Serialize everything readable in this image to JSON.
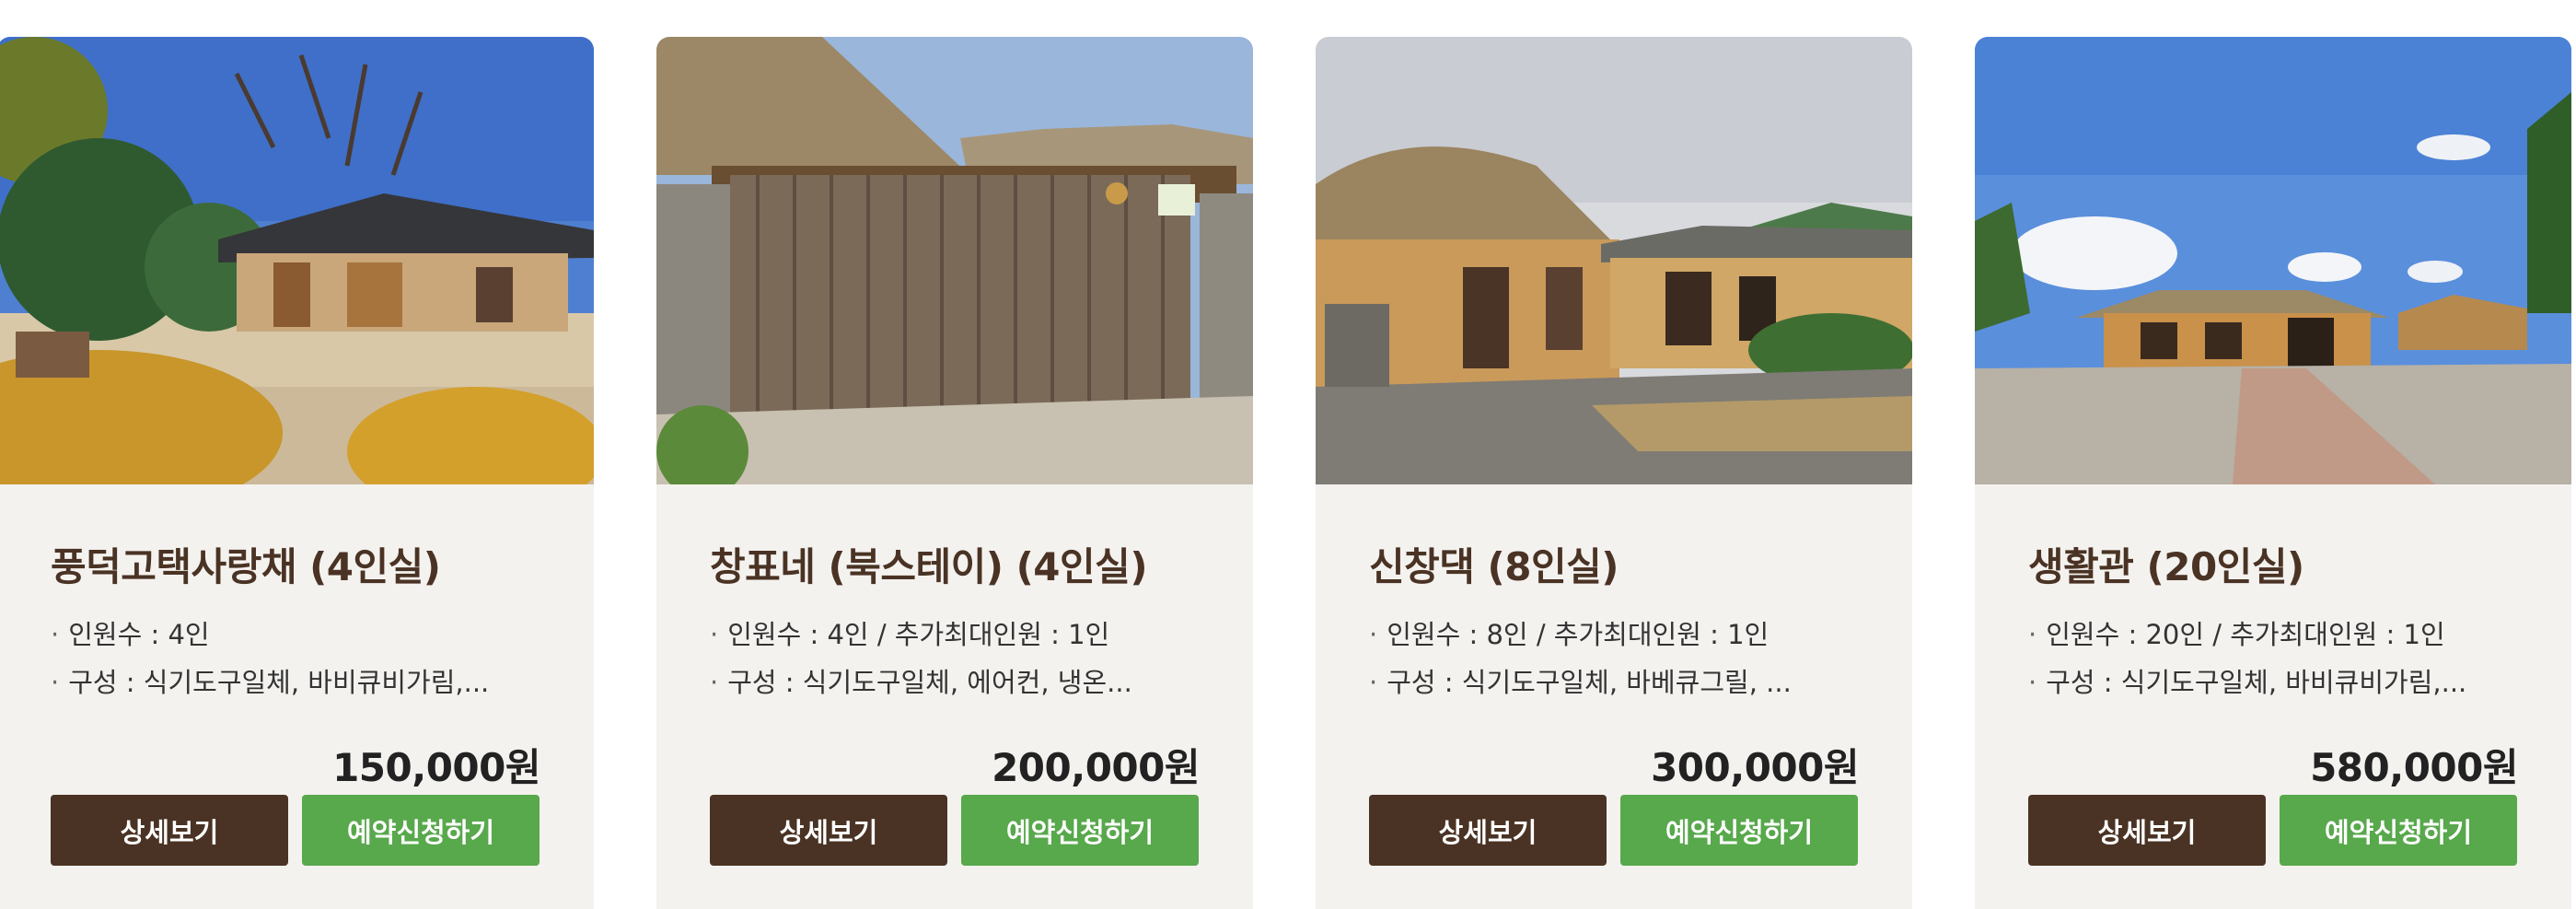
{
  "colors": {
    "brown": "#4a3324",
    "green": "#58a84c",
    "card_bg": "#f4f2ef"
  },
  "rooms": [
    {
      "title": "풍덕고택사랑채 (4인실)",
      "info_line1": "인원수 : 4인",
      "info_line2": "구성 : 식기도구일체, 바비큐비가림,...",
      "price": "150,000원",
      "detail_label": "상세보기",
      "reserve_label": "예약신청하기"
    },
    {
      "title": "창표네 (북스테이) (4인실)",
      "info_line1": "인원수 : 4인 / 추가최대인원 : 1인",
      "info_line2": "구성 : 식기도구일체, 에어컨, 냉온...",
      "price": "200,000원",
      "detail_label": "상세보기",
      "reserve_label": "예약신청하기"
    },
    {
      "title": "신창댁 (8인실)",
      "info_line1": "인원수 : 8인 / 추가최대인원 : 1인",
      "info_line2": "구성 : 식기도구일체, 바베큐그릴, ...",
      "price": "300,000원",
      "detail_label": "상세보기",
      "reserve_label": "예약신청하기"
    },
    {
      "title": "생활관 (20인실)",
      "info_line1": "인원수 : 20인 / 추가최대인원 : 1인",
      "info_line2": "구성 : 식기도구일체, 바비큐비가림,...",
      "price": "580,000원",
      "detail_label": "상세보기",
      "reserve_label": "예약신청하기"
    }
  ]
}
